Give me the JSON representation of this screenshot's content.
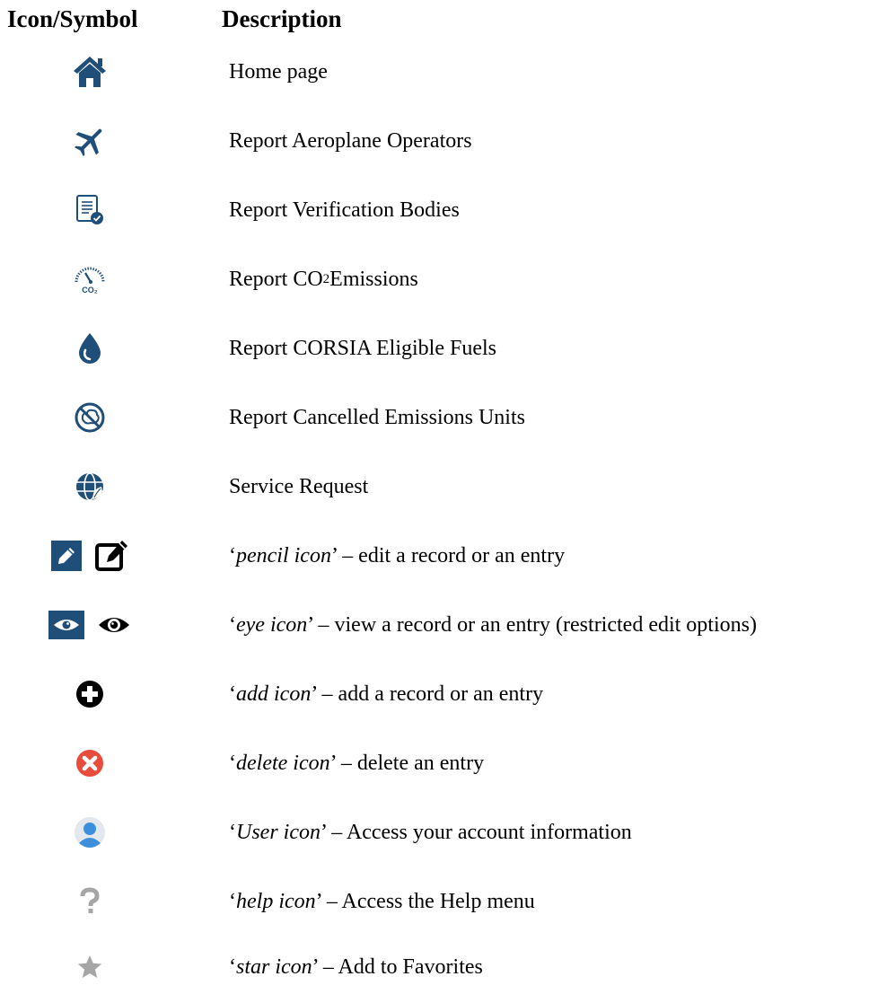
{
  "header": {
    "icon_col": "Icon/Symbol",
    "desc_col": "Description"
  },
  "colors": {
    "navy": "#1f4e79",
    "red": "#e74c3c",
    "user_blue": "#3d8edb",
    "grey": "#a6a6a6"
  },
  "rows": [
    {
      "icon": "home-icon",
      "text": "Home page"
    },
    {
      "icon": "plane-icon",
      "text": "Report Aeroplane Operators"
    },
    {
      "icon": "document-check-icon",
      "text": "Report Verification Bodies"
    },
    {
      "icon": "co2-gauge-icon",
      "pre": "Report CO",
      "sub": "2",
      "post": " Emissions"
    },
    {
      "icon": "fuel-drop-icon",
      "text": "Report CORSIA Eligible Fuels"
    },
    {
      "icon": "cancelled-units-icon",
      "text": "Report Cancelled Emissions Units"
    },
    {
      "icon": "globe-leaf-icon",
      "text": "Service Request"
    },
    {
      "icon": "pencil-icon",
      "open": "‘",
      "ital": "pencil icon",
      "rest": "’ – edit a record or an entry"
    },
    {
      "icon": "eye-icon",
      "open": "‘",
      "ital": "eye icon",
      "rest": "’ – view a record or an entry (restricted edit options)"
    },
    {
      "icon": "add-icon",
      "open": "‘",
      "ital": "add icon",
      "rest": "’ – add a record or an entry"
    },
    {
      "icon": "delete-icon",
      "open": "‘",
      "ital": "delete icon",
      "rest": "’ – delete an entry"
    },
    {
      "icon": "user-icon",
      "open": "‘",
      "ital": "User icon",
      "rest": "’ – Access your account information"
    },
    {
      "icon": "help-icon",
      "open": "‘",
      "ital": "help icon",
      "rest": "’ – Access the Help menu"
    },
    {
      "icon": "star-icon",
      "open": "‘",
      "ital": "star icon",
      "rest": "’ – Add to Favorites"
    }
  ]
}
